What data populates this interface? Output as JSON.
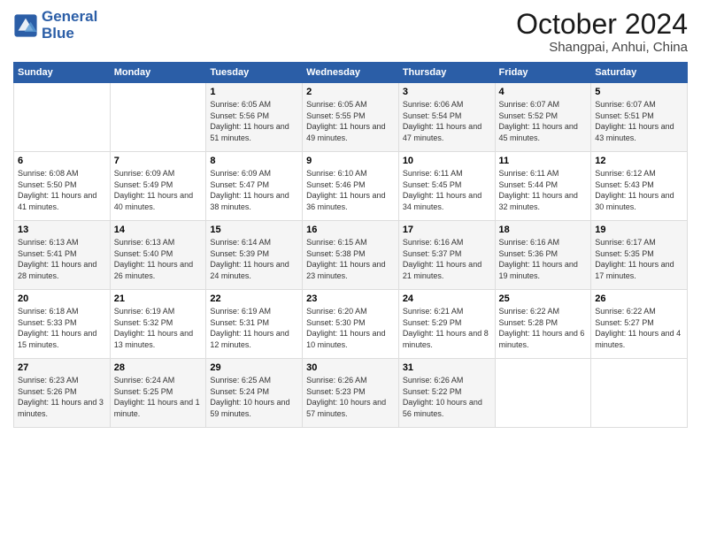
{
  "logo": {
    "line1": "General",
    "line2": "Blue"
  },
  "title": "October 2024",
  "subtitle": "Shangpai, Anhui, China",
  "weekdays": [
    "Sunday",
    "Monday",
    "Tuesday",
    "Wednesday",
    "Thursday",
    "Friday",
    "Saturday"
  ],
  "weeks": [
    [
      {
        "day": "",
        "info": ""
      },
      {
        "day": "",
        "info": ""
      },
      {
        "day": "1",
        "info": "Sunrise: 6:05 AM\nSunset: 5:56 PM\nDaylight: 11 hours and 51 minutes."
      },
      {
        "day": "2",
        "info": "Sunrise: 6:05 AM\nSunset: 5:55 PM\nDaylight: 11 hours and 49 minutes."
      },
      {
        "day": "3",
        "info": "Sunrise: 6:06 AM\nSunset: 5:54 PM\nDaylight: 11 hours and 47 minutes."
      },
      {
        "day": "4",
        "info": "Sunrise: 6:07 AM\nSunset: 5:52 PM\nDaylight: 11 hours and 45 minutes."
      },
      {
        "day": "5",
        "info": "Sunrise: 6:07 AM\nSunset: 5:51 PM\nDaylight: 11 hours and 43 minutes."
      }
    ],
    [
      {
        "day": "6",
        "info": "Sunrise: 6:08 AM\nSunset: 5:50 PM\nDaylight: 11 hours and 41 minutes."
      },
      {
        "day": "7",
        "info": "Sunrise: 6:09 AM\nSunset: 5:49 PM\nDaylight: 11 hours and 40 minutes."
      },
      {
        "day": "8",
        "info": "Sunrise: 6:09 AM\nSunset: 5:47 PM\nDaylight: 11 hours and 38 minutes."
      },
      {
        "day": "9",
        "info": "Sunrise: 6:10 AM\nSunset: 5:46 PM\nDaylight: 11 hours and 36 minutes."
      },
      {
        "day": "10",
        "info": "Sunrise: 6:11 AM\nSunset: 5:45 PM\nDaylight: 11 hours and 34 minutes."
      },
      {
        "day": "11",
        "info": "Sunrise: 6:11 AM\nSunset: 5:44 PM\nDaylight: 11 hours and 32 minutes."
      },
      {
        "day": "12",
        "info": "Sunrise: 6:12 AM\nSunset: 5:43 PM\nDaylight: 11 hours and 30 minutes."
      }
    ],
    [
      {
        "day": "13",
        "info": "Sunrise: 6:13 AM\nSunset: 5:41 PM\nDaylight: 11 hours and 28 minutes."
      },
      {
        "day": "14",
        "info": "Sunrise: 6:13 AM\nSunset: 5:40 PM\nDaylight: 11 hours and 26 minutes."
      },
      {
        "day": "15",
        "info": "Sunrise: 6:14 AM\nSunset: 5:39 PM\nDaylight: 11 hours and 24 minutes."
      },
      {
        "day": "16",
        "info": "Sunrise: 6:15 AM\nSunset: 5:38 PM\nDaylight: 11 hours and 23 minutes."
      },
      {
        "day": "17",
        "info": "Sunrise: 6:16 AM\nSunset: 5:37 PM\nDaylight: 11 hours and 21 minutes."
      },
      {
        "day": "18",
        "info": "Sunrise: 6:16 AM\nSunset: 5:36 PM\nDaylight: 11 hours and 19 minutes."
      },
      {
        "day": "19",
        "info": "Sunrise: 6:17 AM\nSunset: 5:35 PM\nDaylight: 11 hours and 17 minutes."
      }
    ],
    [
      {
        "day": "20",
        "info": "Sunrise: 6:18 AM\nSunset: 5:33 PM\nDaylight: 11 hours and 15 minutes."
      },
      {
        "day": "21",
        "info": "Sunrise: 6:19 AM\nSunset: 5:32 PM\nDaylight: 11 hours and 13 minutes."
      },
      {
        "day": "22",
        "info": "Sunrise: 6:19 AM\nSunset: 5:31 PM\nDaylight: 11 hours and 12 minutes."
      },
      {
        "day": "23",
        "info": "Sunrise: 6:20 AM\nSunset: 5:30 PM\nDaylight: 11 hours and 10 minutes."
      },
      {
        "day": "24",
        "info": "Sunrise: 6:21 AM\nSunset: 5:29 PM\nDaylight: 11 hours and 8 minutes."
      },
      {
        "day": "25",
        "info": "Sunrise: 6:22 AM\nSunset: 5:28 PM\nDaylight: 11 hours and 6 minutes."
      },
      {
        "day": "26",
        "info": "Sunrise: 6:22 AM\nSunset: 5:27 PM\nDaylight: 11 hours and 4 minutes."
      }
    ],
    [
      {
        "day": "27",
        "info": "Sunrise: 6:23 AM\nSunset: 5:26 PM\nDaylight: 11 hours and 3 minutes."
      },
      {
        "day": "28",
        "info": "Sunrise: 6:24 AM\nSunset: 5:25 PM\nDaylight: 11 hours and 1 minute."
      },
      {
        "day": "29",
        "info": "Sunrise: 6:25 AM\nSunset: 5:24 PM\nDaylight: 10 hours and 59 minutes."
      },
      {
        "day": "30",
        "info": "Sunrise: 6:26 AM\nSunset: 5:23 PM\nDaylight: 10 hours and 57 minutes."
      },
      {
        "day": "31",
        "info": "Sunrise: 6:26 AM\nSunset: 5:22 PM\nDaylight: 10 hours and 56 minutes."
      },
      {
        "day": "",
        "info": ""
      },
      {
        "day": "",
        "info": ""
      }
    ]
  ]
}
